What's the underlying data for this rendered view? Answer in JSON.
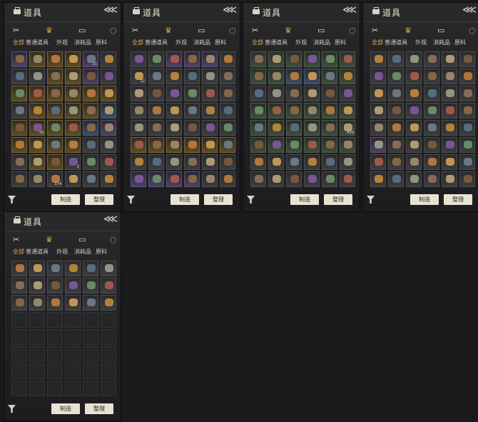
{
  "panels": [
    {
      "title": "道具",
      "tabs": [
        "全部",
        "普通道具",
        "外观",
        "消耗品",
        "原料"
      ],
      "buttons": [
        "制造",
        "整理"
      ],
      "counts": [
        "",
        "",
        "",
        "",
        "21",
        "",
        "",
        "",
        "",
        "",
        "",
        "",
        "",
        "",
        "",
        "",
        "",
        "",
        "",
        "",
        "",
        "",
        "",
        "",
        "",
        "19",
        "",
        "",
        "",
        "",
        "",
        "",
        "",
        "",
        "",
        "",
        "",
        "",
        "",
        "2",
        "",
        "",
        "",
        "",
        "174",
        "",
        "",
        "",
        "",
        "",
        "",
        "",
        "",
        "",
        "",
        "",
        "",
        "",
        "",
        "",
        "",
        "",
        "",
        ""
      ]
    },
    {
      "title": "道具",
      "tabs": [
        "全部",
        "普通道具",
        "外观",
        "消耗品",
        "原料"
      ],
      "buttons": [
        "制造",
        "整理"
      ],
      "counts": [
        "",
        "",
        "",
        "",
        "",
        "",
        "12",
        "",
        "",
        "",
        "",
        "",
        "",
        "",
        "",
        "",
        "",
        "",
        "",
        "",
        "",
        "",
        "",
        "",
        "",
        "",
        "",
        "",
        "",
        "",
        "",
        "",
        "",
        "",
        "",
        "",
        "",
        "",
        "",
        "",
        "",
        "",
        "",
        "",
        "",
        "",
        "",
        "",
        "",
        "",
        "",
        "",
        "",
        "",
        "",
        "",
        "",
        "",
        "",
        "",
        ""
      ]
    },
    {
      "title": "道具",
      "tabs": [
        "全部",
        "普通道具",
        "外观",
        "消耗品",
        "原料"
      ],
      "buttons": [
        "制造",
        "整理"
      ],
      "counts": [
        "",
        "",
        "",
        "",
        "",
        "",
        "",
        "",
        "",
        "",
        "",
        "",
        "",
        "",
        "",
        "",
        "",
        "",
        "",
        "",
        "",
        "",
        "",
        "",
        "",
        "",
        "",
        "",
        "",
        "420",
        "",
        "",
        "",
        "",
        "",
        "",
        "",
        "",
        "",
        "",
        "",
        "",
        "",
        "",
        "",
        "",
        "",
        "",
        "",
        "",
        "",
        "",
        "",
        "",
        "",
        "",
        "",
        "",
        "",
        "",
        "",
        ""
      ]
    },
    {
      "title": "道具",
      "tabs": [
        "全部",
        "普通道具",
        "外观",
        "消耗品",
        "原料"
      ],
      "buttons": [
        "制造",
        "整理"
      ],
      "counts": [
        "",
        "",
        "",
        "",
        "",
        "",
        "",
        "",
        "",
        "",
        "",
        "",
        "",
        "",
        "",
        "",
        "",
        "",
        "",
        "",
        "",
        "",
        "",
        "",
        "",
        "",
        "",
        "",
        "",
        "",
        "",
        "",
        "",
        "",
        "",
        "",
        "",
        "",
        "",
        "",
        "",
        "",
        "",
        "",
        "",
        "",
        "",
        "",
        "",
        "",
        "",
        "",
        "",
        "",
        "",
        "",
        "",
        "",
        "",
        "",
        "",
        ""
      ]
    },
    {
      "title": "道具",
      "tabs": [
        "全部",
        "普通道具",
        "外观",
        "消耗品",
        "原料"
      ],
      "buttons": [
        "制造",
        "整理"
      ],
      "counts": [
        "",
        "",
        "",
        "",
        "",
        "",
        "",
        "",
        "",
        "",
        "",
        "",
        "",
        "",
        "",
        "",
        "",
        "",
        "",
        "",
        "",
        "",
        "",
        "",
        "",
        "",
        "",
        "",
        "",
        "",
        "",
        "",
        "",
        "",
        "",
        "",
        "",
        "",
        "",
        "",
        "",
        "",
        "",
        "",
        "",
        "",
        "",
        "",
        "",
        "",
        "",
        "",
        "",
        "",
        "",
        "",
        "",
        "",
        "",
        "",
        ""
      ]
    }
  ]
}
